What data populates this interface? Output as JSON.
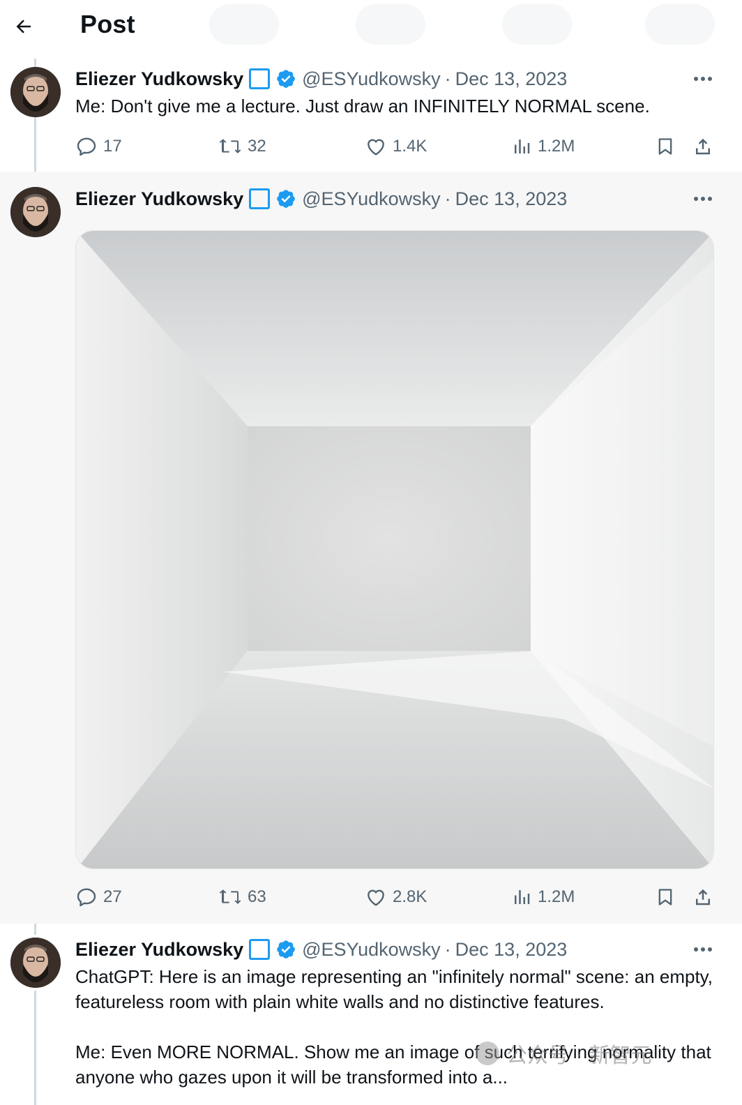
{
  "header": {
    "title": "Post",
    "back_icon": "arrow-left-icon"
  },
  "colors": {
    "accent": "#1d9bf0",
    "secondary_text": "#536471",
    "thread_line": "#cfd9de"
  },
  "tweets": [
    {
      "author": "Eliezer Yudkowsky",
      "handle": "@ESYudkowsky",
      "separator": "·",
      "date": "Dec 13, 2023",
      "text": "Me:  Don't give me a lecture.  Just draw an INFINITELY NORMAL scene.",
      "replies": "17",
      "retweets": "32",
      "likes": "1.4K",
      "views": "1.2M"
    },
    {
      "author": "Eliezer Yudkowsky",
      "handle": "@ESYudkowsky",
      "separator": "·",
      "date": "Dec 13, 2023",
      "replies": "27",
      "retweets": "63",
      "likes": "2.8K",
      "views": "1.2M"
    },
    {
      "author": "Eliezer Yudkowsky",
      "handle": "@ESYudkowsky",
      "separator": "·",
      "date": "Dec 13, 2023",
      "text_p1": "ChatGPT:  Here is an image representing an \"infinitely normal\" scene: an empty, featureless room with plain white walls and no distinctive features.",
      "text_p2": "Me:  Even MORE NORMAL.  Show me an image of such terrifying normality that anyone who gazes upon it will be transformed into a..."
    }
  ],
  "watermark": {
    "text": "公众号 · 新智元"
  }
}
